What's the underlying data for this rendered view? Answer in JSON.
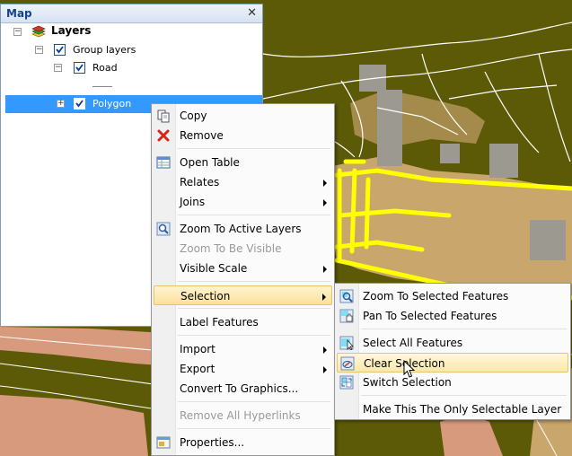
{
  "toc": {
    "title": "Map",
    "close_glyph": "✕",
    "tree": {
      "root": "Layers",
      "group": "Group layers",
      "road": "Road",
      "polygon": "Polygon"
    }
  },
  "context_menu": {
    "items": [
      {
        "label": "Copy",
        "icon": "copy-icon",
        "enabled": true,
        "submenu": false
      },
      {
        "label": "Remove",
        "icon": "remove-icon",
        "enabled": true,
        "submenu": false
      },
      {
        "label": "Open Table",
        "icon": "table-icon",
        "enabled": true,
        "submenu": false
      },
      {
        "label": "Relates",
        "icon": null,
        "enabled": true,
        "submenu": true
      },
      {
        "label": "Joins",
        "icon": null,
        "enabled": true,
        "submenu": true
      },
      {
        "label": "Zoom To Active Layers",
        "icon": "zoom-layers-icon",
        "enabled": true,
        "submenu": false
      },
      {
        "label": "Zoom To Be Visible",
        "icon": null,
        "enabled": false,
        "submenu": false
      },
      {
        "label": "Visible Scale",
        "icon": null,
        "enabled": true,
        "submenu": true
      },
      {
        "label": "Selection",
        "icon": null,
        "enabled": true,
        "submenu": true,
        "highlighted": true
      },
      {
        "label": "Label Features",
        "icon": null,
        "enabled": true,
        "submenu": false
      },
      {
        "label": "Import",
        "icon": null,
        "enabled": true,
        "submenu": true
      },
      {
        "label": "Export",
        "icon": null,
        "enabled": true,
        "submenu": true
      },
      {
        "label": "Convert To Graphics...",
        "icon": null,
        "enabled": true,
        "submenu": false
      },
      {
        "label": "Remove All Hyperlinks",
        "icon": null,
        "enabled": false,
        "submenu": false
      },
      {
        "label": "Properties...",
        "icon": "properties-icon",
        "enabled": true,
        "submenu": false
      }
    ]
  },
  "selection_submenu": {
    "items": [
      {
        "label": "Zoom To Selected Features",
        "icon": "zoom-selected-icon"
      },
      {
        "label": "Pan To Selected Features",
        "icon": "pan-selected-icon"
      },
      {
        "label": "Select All Features",
        "icon": "select-all-icon"
      },
      {
        "label": "Clear Selection",
        "icon": "clear-selection-icon",
        "highlighted": true
      },
      {
        "label": "Switch Selection",
        "icon": "switch-selection-icon"
      },
      {
        "label": "Make This The Only Selectable Layer",
        "icon": null
      }
    ]
  },
  "colors": {
    "map_background": "#5c5a06",
    "parcel_fill": "#c9a66b",
    "building_fill": "#9c9a90",
    "road_yellow": "#ffff00",
    "salmon": "#d89a7c",
    "selection_blue": "#3399ff",
    "menu_highlight": "#fbe09a"
  }
}
